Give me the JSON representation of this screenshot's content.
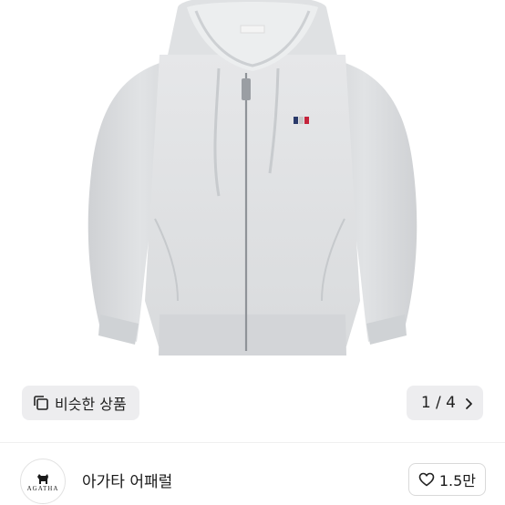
{
  "product": {
    "image_alt": "회색 후드 집업",
    "label_tag": "AGATHA"
  },
  "similar": {
    "label": "비슷한 상품",
    "icon": "copy-icon"
  },
  "gallery": {
    "counter": "1 / 4",
    "next_icon": "chevron-right-icon"
  },
  "seller": {
    "logo_text": "AGATHA",
    "name": "아가타 어패럴"
  },
  "like": {
    "icon": "heart-outline-icon",
    "count": "1.5만"
  }
}
